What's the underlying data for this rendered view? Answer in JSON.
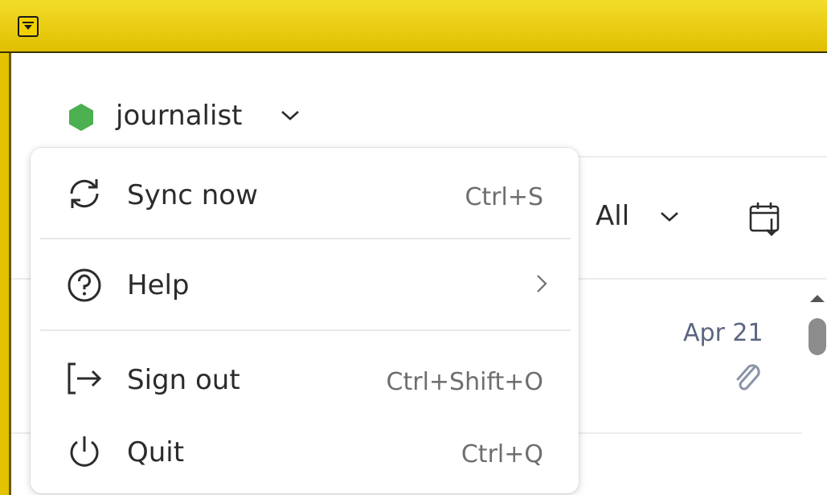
{
  "account": {
    "name": "journalist",
    "status_color": "#4caf50"
  },
  "filter": {
    "label": "All"
  },
  "message": {
    "date": "Apr 21"
  },
  "menu": {
    "items": [
      {
        "label": "Sync now",
        "shortcut": "Ctrl+S",
        "icon": "sync-icon"
      },
      {
        "label": "Help",
        "shortcut": "",
        "icon": "help-icon"
      },
      {
        "label": "Sign out",
        "shortcut": "Ctrl+Shift+O",
        "icon": "sign-out-icon"
      },
      {
        "label": "Quit",
        "shortcut": "Ctrl+Q",
        "icon": "power-icon"
      }
    ]
  },
  "colors": {
    "titlebar": "#e8c900",
    "accent_status": "#4caf50",
    "date_text": "#5b6680"
  }
}
